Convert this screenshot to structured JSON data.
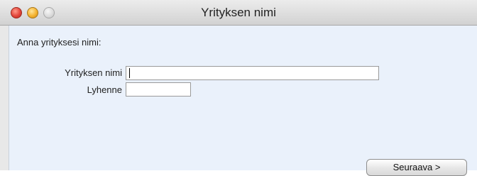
{
  "window": {
    "title": "Yrityksen nimi"
  },
  "content": {
    "prompt": "Anna yrityksesi nimi:",
    "fields": {
      "company_name_label": "Yrityksen nimi",
      "company_name_value": "",
      "abbreviation_label": "Lyhenne",
      "abbreviation_value": ""
    },
    "next_button_label": "Seuraava >"
  },
  "icons": {
    "close": "close-icon",
    "minimize": "minimize-icon",
    "zoom": "zoom-icon"
  },
  "colors": {
    "content_background": "#eaf1fb",
    "close": "#e2453a",
    "minimize": "#f4b22e"
  }
}
